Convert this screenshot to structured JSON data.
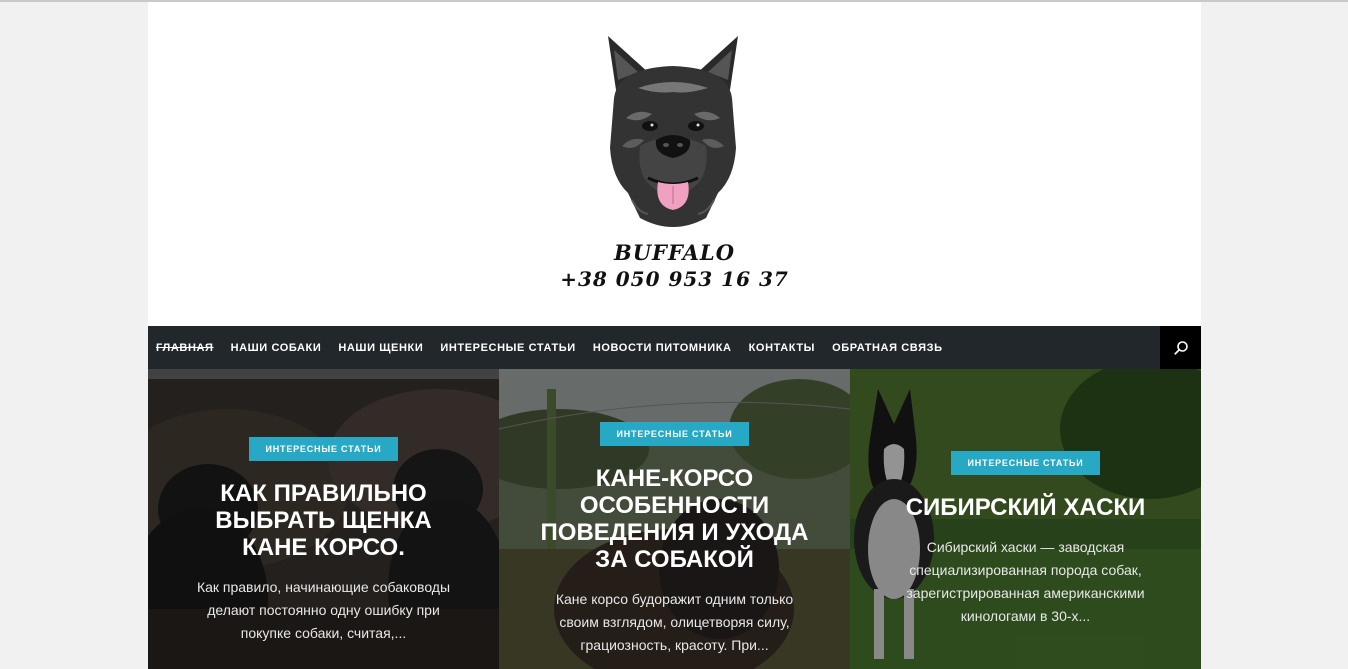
{
  "header": {
    "brand_name": "BUFFALO",
    "phone": "+38 050 953 16 37",
    "logo_icon": "cane-corso-head-logo"
  },
  "nav": {
    "items": [
      {
        "label": "ГЛАВНАЯ",
        "active": true
      },
      {
        "label": "НАШИ СОБАКИ"
      },
      {
        "label": "НАШИ ЩЕНКИ"
      },
      {
        "label": "ИНТЕРЕСНЫЕ СТАТЬИ"
      },
      {
        "label": "НОВОСТИ ПИТОМНИКА"
      },
      {
        "label": "КОНТАКТЫ"
      },
      {
        "label": "ОБРАТНАЯ СВЯЗЬ"
      }
    ],
    "search_icon": "search-icon"
  },
  "cards": [
    {
      "category": "ИНТЕРЕСНЫЕ СТАТЬИ",
      "title": "КАК ПРАВИЛЬНО ВЫБРАТЬ ЩЕНКА КАНЕ КОРСО.",
      "excerpt": "Как правило, начинающие собаководы делают постоянно одну ошибку при покупке собаки, считая,..."
    },
    {
      "category": "ИНТЕРЕСНЫЕ СТАТЬИ",
      "title": "КАНЕ-КОРСО ОСОБЕННОСТИ ПОВЕДЕНИЯ И УХОДА ЗА СОБАКОЙ",
      "excerpt": "Кане корсо будоражит одним только своим взглядом, олицетворяя силу, грациозность, красоту. При..."
    },
    {
      "category": "ИНТЕРЕСНЫЕ СТАТЬИ",
      "title": "СИБИРСКИЙ ХАСКИ",
      "excerpt": "Сибирский хаски — заводская специализированная порода собак, зарегистрированная американскими кинологами в 30-х..."
    }
  ],
  "colors": {
    "accent": "#27a9c6",
    "nav_bg": "#22272b"
  }
}
